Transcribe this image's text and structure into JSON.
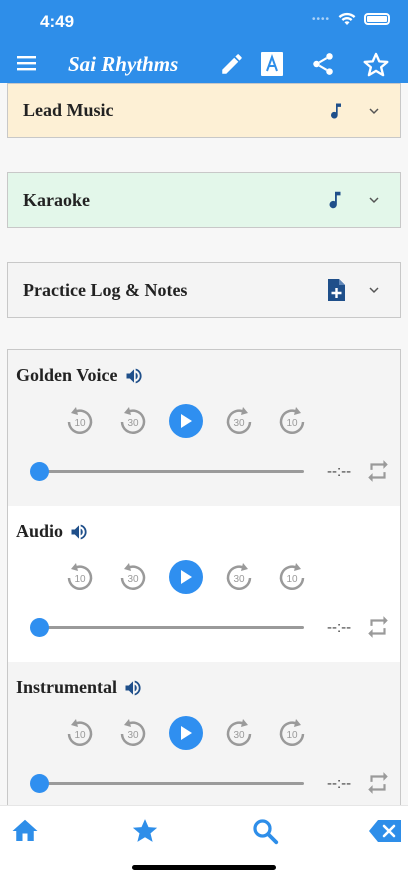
{
  "status_bar": {
    "time": "4:49",
    "signal_dots": "••••"
  },
  "app_bar": {
    "title": "Sai Rhythms",
    "icons": [
      "menu-icon",
      "pencil-icon",
      "font-a-icon",
      "share-icon",
      "star-outline-icon"
    ]
  },
  "sections": [
    {
      "label": "Lead Music",
      "icon": "music-note-icon",
      "bg": "#fdf0d5"
    },
    {
      "label": "Karaoke",
      "icon": "music-note-icon",
      "bg": "#e3f7ea"
    },
    {
      "label": "Practice Log & Notes",
      "icon": "note-add-icon",
      "bg": "#f4f4f4"
    }
  ],
  "players": [
    {
      "title": "Golden Voice",
      "time": "--:--",
      "bg": "#f4f4f4",
      "progress": 0
    },
    {
      "title": "Audio",
      "time": "--:--",
      "bg": "#ffffff",
      "progress": 0
    },
    {
      "title": "Instrumental",
      "time": "--:--",
      "bg": "#f4f4f4",
      "progress": 0
    }
  ],
  "player_controls": {
    "rewind_10": "10",
    "rewind_30": "30",
    "forward_30": "30",
    "forward_10": "10"
  },
  "bottom_bar": {
    "icons": [
      "home-icon",
      "star-icon",
      "search-icon",
      "backspace-icon"
    ]
  },
  "colors": {
    "accent": "#2e8ee9",
    "icon_dark": "#1f4f8a",
    "control_gray": "#9a9a9a"
  }
}
